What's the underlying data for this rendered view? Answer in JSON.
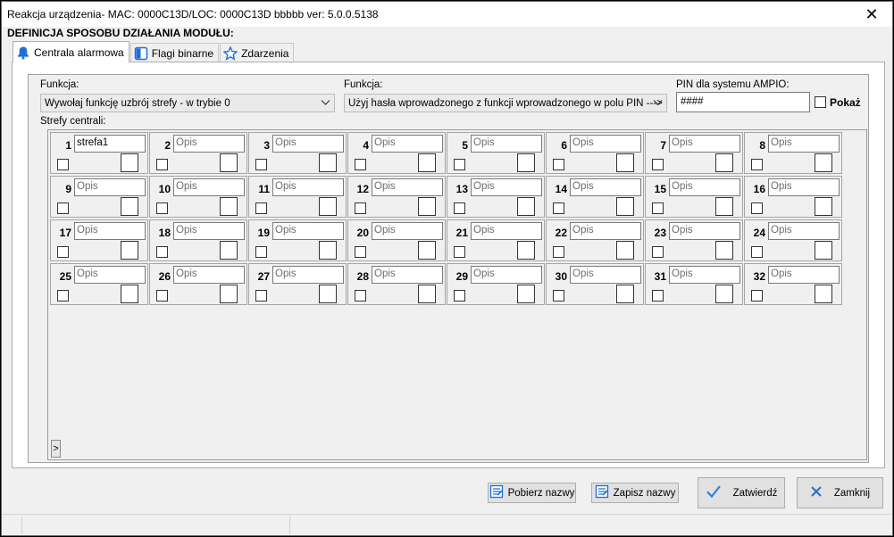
{
  "window": {
    "title": "Reakcja urządzenia- MAC: 0000C13D/LOC: 0000C13D bbbbb ver: 5.0.0.5138",
    "close_glyph": "✕"
  },
  "heading": "DEFINICJA SPOSOBU DZIAŁANIA MODUŁU:",
  "tabs": [
    {
      "label": "Centrala alarmowa",
      "icon": "bell-icon",
      "active": true
    },
    {
      "label": "Flagi binarne",
      "icon": "flag-icon",
      "active": false
    },
    {
      "label": "Zdarzenia",
      "icon": "star-icon",
      "active": false
    }
  ],
  "form": {
    "funkcja1_label": "Funkcja:",
    "funkcja1_value": "Wywołaj funkcję uzbrój strefy - w trybie 0",
    "funkcja2_label": "Funkcja:",
    "funkcja2_value": "Użyj hasła wprowadzonego z funkcji wprowadzonego w polu PIN --->",
    "pin_label": "PIN dla systemu AMPIO:",
    "pin_value": "####",
    "pokaz_label": "Pokaż",
    "zones_label": "Strefy centrali:"
  },
  "zones": [
    {
      "num": "1",
      "desc": "strefa1"
    },
    {
      "num": "2",
      "desc": "Opis"
    },
    {
      "num": "3",
      "desc": "Opis"
    },
    {
      "num": "4",
      "desc": "Opis"
    },
    {
      "num": "5",
      "desc": "Opis"
    },
    {
      "num": "6",
      "desc": "Opis"
    },
    {
      "num": "7",
      "desc": "Opis"
    },
    {
      "num": "8",
      "desc": "Opis"
    },
    {
      "num": "9",
      "desc": "Opis"
    },
    {
      "num": "10",
      "desc": "Opis"
    },
    {
      "num": "11",
      "desc": "Opis"
    },
    {
      "num": "12",
      "desc": "Opis"
    },
    {
      "num": "13",
      "desc": "Opis"
    },
    {
      "num": "14",
      "desc": "Opis"
    },
    {
      "num": "15",
      "desc": "Opis"
    },
    {
      "num": "16",
      "desc": "Opis"
    },
    {
      "num": "17",
      "desc": "Opis"
    },
    {
      "num": "18",
      "desc": "Opis"
    },
    {
      "num": "19",
      "desc": "Opis"
    },
    {
      "num": "20",
      "desc": "Opis"
    },
    {
      "num": "21",
      "desc": "Opis"
    },
    {
      "num": "22",
      "desc": "Opis"
    },
    {
      "num": "23",
      "desc": "Opis"
    },
    {
      "num": "24",
      "desc": "Opis"
    },
    {
      "num": "25",
      "desc": "Opis"
    },
    {
      "num": "26",
      "desc": "Opis"
    },
    {
      "num": "27",
      "desc": "Opis"
    },
    {
      "num": "28",
      "desc": "Opis"
    },
    {
      "num": "29",
      "desc": "Opis"
    },
    {
      "num": "30",
      "desc": "Opis"
    },
    {
      "num": "31",
      "desc": "Opis"
    },
    {
      "num": "32",
      "desc": "Opis"
    }
  ],
  "scroll_glyph": ">",
  "buttons": {
    "pobierz": "Pobierz nazwy",
    "zapisz": "Zapisz nazwy",
    "zatwierdz": "Zatwierdź",
    "zamknij": "Zamknij"
  },
  "colors": {
    "accent_blue": "#1e6fd9",
    "check_blue": "#2f7fd8",
    "close_x_blue": "#2b6cc4"
  }
}
